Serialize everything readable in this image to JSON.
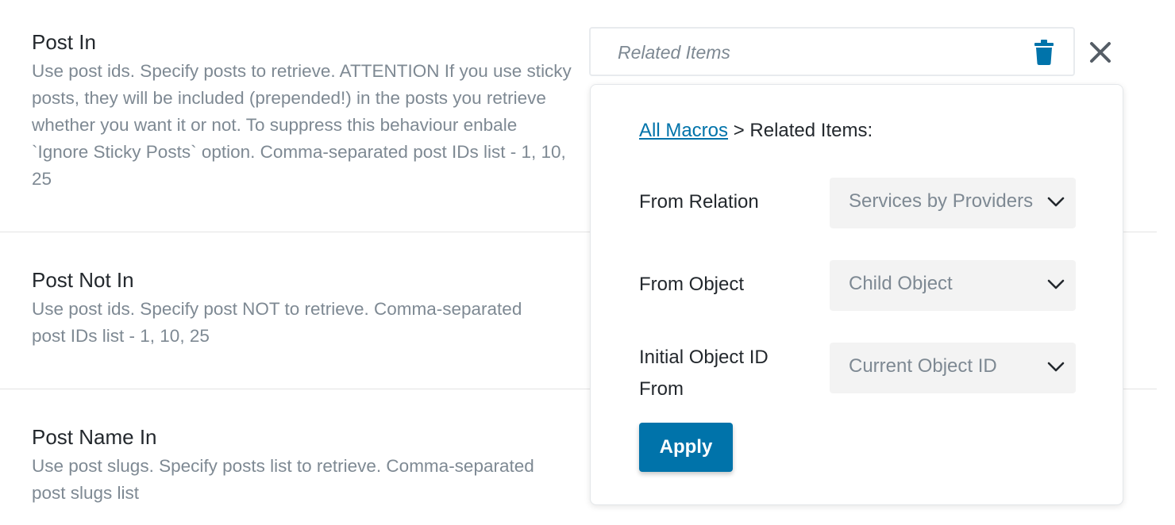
{
  "fields": [
    {
      "title": "Post In",
      "description": "Use post ids. Specify posts to retrieve. ATTENTION If you use sticky posts, they will be included (prepended!) in the posts you retrieve whether you want it or not. To suppress this behaviour enbale `Ignore Sticky Posts` option. Comma-separated post IDs list - 1, 10, 25"
    },
    {
      "title": "Post Not In",
      "description": "Use post ids. Specify post NOT to retrieve. Comma-separated post IDs list - 1, 10, 25"
    },
    {
      "title": "Post Name In",
      "description": "Use post slugs. Specify posts list to retrieve. Comma-separated post slugs list"
    }
  ],
  "macro_input": {
    "value": "Related Items"
  },
  "icons": {
    "trash": "trash-icon",
    "close": "close-icon",
    "chevron": "chevron-down-icon"
  },
  "popover": {
    "breadcrumb_link": "All Macros",
    "breadcrumb_rest": " > Related Items:",
    "rows": [
      {
        "label": "From Relation",
        "value": "Services by Providers"
      },
      {
        "label": "From Object",
        "value": "Child Object"
      },
      {
        "label": "Initial Object ID From",
        "value": "Current Object ID"
      }
    ],
    "apply_label": "Apply"
  },
  "colors": {
    "accent": "#0073aa",
    "muted_text": "#7e8993",
    "text": "#23282d"
  }
}
